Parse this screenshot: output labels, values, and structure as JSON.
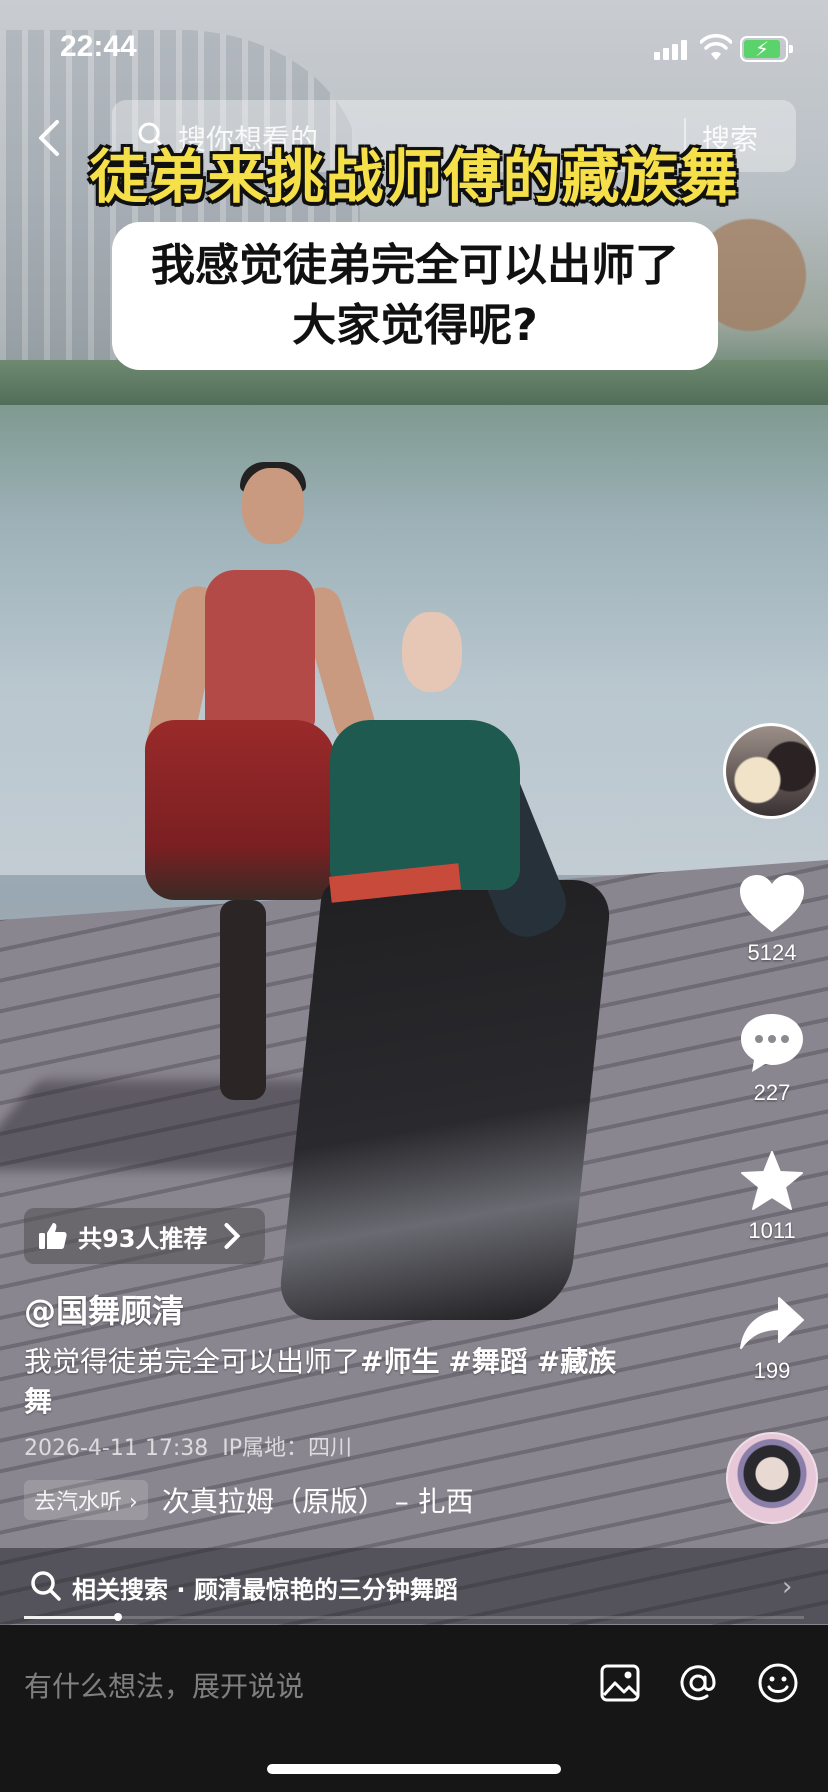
{
  "status_bar": {
    "time": "22:44"
  },
  "top_bar": {
    "search_placeholder": "搜你想看的",
    "search_button": "搜索"
  },
  "video": {
    "title_overlay": "徒弟来挑战师傅的藏族舞",
    "caption_line1": "我感觉徒弟完全可以出师了",
    "caption_line2": "大家觉得呢?"
  },
  "actions": {
    "like_count": "5124",
    "comment_count": "227",
    "favorite_count": "1011",
    "share_count": "199"
  },
  "info": {
    "recommend_label": "共93人推荐",
    "author_name": "@国舞顾清",
    "description_text": "我觉得徒弟完全可以出师了",
    "tags": [
      "#师生",
      "#舞蹈",
      "#藏族舞"
    ],
    "timestamp": "2026-4-11 17:38",
    "ip_location": "IP属地：四川",
    "music_source": "去汽水听",
    "music_title": "次真拉姆（原版） – 扎西"
  },
  "related_search": {
    "label": "相关搜索",
    "query": "· 顾清最惊艳的三分钟舞蹈"
  },
  "playback": {
    "progress": 0.12
  },
  "comment_bar": {
    "placeholder": "有什么想法，展开说说"
  },
  "colors": {
    "title_yellow": "#f5e04a",
    "comment_bar_bg": "#161616",
    "battery_green": "#5ad36a"
  },
  "icons": [
    "back-icon",
    "search-icon",
    "heart-icon",
    "comment-icon",
    "star-icon",
    "share-icon",
    "thumbs-up-icon",
    "chevron-right-icon",
    "image-icon",
    "at-icon",
    "emoji-icon",
    "signal-icon",
    "wifi-icon",
    "battery-icon"
  ]
}
